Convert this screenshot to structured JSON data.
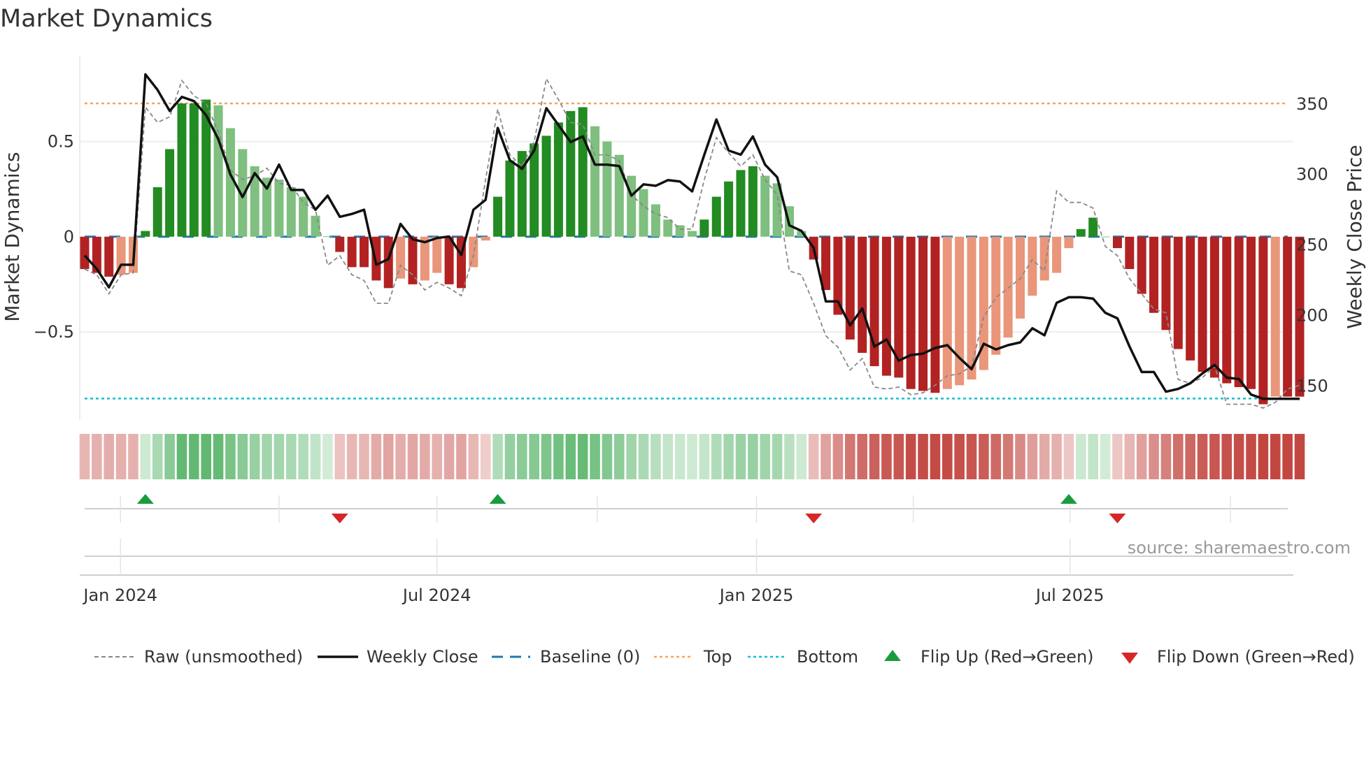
{
  "chart_data": {
    "type": "bar",
    "title": "Market Dynamics",
    "ylabel": "Market Dynamics",
    "y2label": "Weekly Close Price",
    "ylim": [
      -0.95,
      0.95
    ],
    "y2lim": [
      130,
      372
    ],
    "yticks": [
      {
        "value": 0.5,
        "label": "0.5"
      },
      {
        "value": 0,
        "label": "0"
      },
      {
        "value": -0.5,
        "label": "−0.5"
      }
    ],
    "y2ticks": [
      {
        "value": 350,
        "label": "350"
      },
      {
        "value": 300,
        "label": "300"
      },
      {
        "value": 250,
        "label": "250"
      },
      {
        "value": 200,
        "label": "200"
      },
      {
        "value": 150,
        "label": "150"
      }
    ],
    "xticks": [
      {
        "week": 2.95,
        "label": "Jan 2024"
      },
      {
        "week": 29.0,
        "label": "Jul 2024"
      },
      {
        "week": 55.3,
        "label": "Jan 2025"
      },
      {
        "week": 81.1,
        "label": "Jul 2025"
      }
    ],
    "minor_xticks": [
      16.0,
      42.2,
      68.2,
      94.3
    ],
    "baseline": 0,
    "top": 0.7,
    "bottom": -0.85,
    "dynamics": [
      -0.17,
      -0.19,
      -0.21,
      -0.2,
      -0.19,
      0.03,
      0.26,
      0.46,
      0.7,
      0.7,
      0.72,
      0.69,
      0.57,
      0.46,
      0.37,
      0.31,
      0.3,
      0.26,
      0.21,
      0.11,
      0.002,
      -0.08,
      -0.16,
      -0.16,
      -0.23,
      -0.27,
      -0.22,
      -0.25,
      -0.23,
      -0.19,
      -0.25,
      -0.27,
      -0.16,
      -0.02,
      0.21,
      0.4,
      0.45,
      0.49,
      0.53,
      0.6,
      0.66,
      0.68,
      0.58,
      0.5,
      0.43,
      0.32,
      0.25,
      0.17,
      0.09,
      0.06,
      0.03,
      0.09,
      0.21,
      0.29,
      0.35,
      0.37,
      0.32,
      0.28,
      0.16,
      0.03,
      -0.12,
      -0.28,
      -0.41,
      -0.54,
      -0.61,
      -0.68,
      -0.73,
      -0.74,
      -0.8,
      -0.81,
      -0.82,
      -0.8,
      -0.78,
      -0.75,
      -0.7,
      -0.62,
      -0.53,
      -0.43,
      -0.31,
      -0.23,
      -0.19,
      -0.06,
      0.04,
      0.1,
      0.001,
      -0.06,
      -0.17,
      -0.3,
      -0.4,
      -0.49,
      -0.59,
      -0.65,
      -0.71,
      -0.74,
      -0.77,
      -0.79,
      -0.8,
      -0.88,
      -0.84,
      -0.84,
      -0.84
    ],
    "raw": [
      -0.17,
      -0.2,
      -0.3,
      -0.2,
      -0.19,
      0.68,
      0.6,
      0.63,
      0.82,
      0.74,
      0.7,
      0.55,
      0.35,
      0.3,
      0.32,
      0.36,
      0.28,
      0.27,
      0.18,
      0.14,
      -0.15,
      -0.1,
      -0.2,
      -0.23,
      -0.35,
      -0.35,
      -0.15,
      -0.2,
      -0.28,
      -0.24,
      -0.27,
      -0.31,
      -0.1,
      0.3,
      0.67,
      0.43,
      0.37,
      0.5,
      0.83,
      0.72,
      0.6,
      0.59,
      0.43,
      0.43,
      0.4,
      0.22,
      0.16,
      0.12,
      0.1,
      0.04,
      0.04,
      0.3,
      0.52,
      0.44,
      0.37,
      0.43,
      0.3,
      0.22,
      -0.18,
      -0.2,
      -0.35,
      -0.52,
      -0.58,
      -0.7,
      -0.64,
      -0.79,
      -0.8,
      -0.79,
      -0.83,
      -0.82,
      -0.78,
      -0.73,
      -0.72,
      -0.68,
      -0.42,
      -0.32,
      -0.27,
      -0.22,
      -0.12,
      -0.18,
      0.24,
      0.18,
      0.18,
      0.15,
      -0.05,
      -0.1,
      -0.22,
      -0.3,
      -0.38,
      -0.4,
      -0.75,
      -0.77,
      -0.74,
      -0.68,
      -0.88,
      -0.88,
      -0.88,
      -0.9,
      -0.87,
      -0.8,
      -0.78
    ],
    "weekly_close": [
      242.6,
      233,
      220,
      236,
      236,
      371,
      360,
      345,
      355,
      352,
      342,
      325,
      300,
      284,
      301,
      290,
      307,
      289,
      289,
      275,
      285,
      270,
      272,
      275,
      236,
      240,
      265,
      254,
      252,
      255,
      256,
      243,
      275,
      282,
      333,
      310,
      304,
      317,
      347,
      335,
      323,
      327,
      307,
      307,
      306,
      285,
      293,
      292,
      296,
      295,
      288,
      314,
      339,
      317,
      314,
      327,
      307,
      298,
      264,
      260,
      248,
      210,
      210,
      193,
      205,
      178,
      183,
      168,
      172,
      173,
      177,
      179,
      170,
      162,
      180,
      176,
      179,
      181,
      191,
      186,
      209,
      213,
      213,
      212,
      202,
      198,
      178,
      160,
      160,
      146,
      148,
      152,
      159,
      165,
      156,
      155,
      144,
      141,
      141,
      141,
      141
    ],
    "flip_up_weeks": [
      5,
      34,
      81
    ],
    "flip_down_weeks": [
      21,
      60,
      85
    ],
    "colors": {
      "strong_up": "#228b22",
      "weak_up": "#7fbf7f",
      "strong_down": "#b22222",
      "weak_down": "#e9967a",
      "baseline": "#1f77b4",
      "top": "#f4a460",
      "bottom": "#17becf",
      "flip_up": "#1a9c3e",
      "flip_down": "#d62728"
    },
    "legend": {
      "raw": "Raw (unsmoothed)",
      "close": "Weekly Close",
      "baseline": "Baseline (0)",
      "top": "Top",
      "bottom": "Bottom",
      "flip_up": "Flip Up (Red→Green)",
      "flip_down": "Flip Down (Green→Red)"
    },
    "source": "source: sharemaestro.com"
  }
}
